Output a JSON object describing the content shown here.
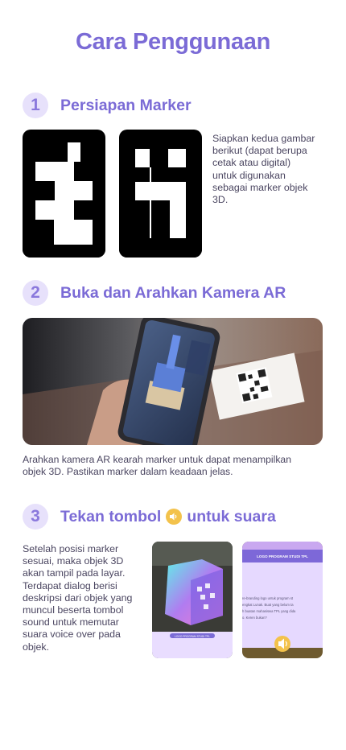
{
  "page": {
    "title": "Cara Penggunaan"
  },
  "step1": {
    "number": "1",
    "title": "Persiapan Marker",
    "description": [
      "Siapkan kedua gambar",
      "berikut (dapat berupa",
      "cetak atau digital)",
      "untuk digunakan",
      "sebagai marker objek",
      "3D."
    ]
  },
  "step2": {
    "number": "2",
    "title": "Buka dan Arahkan Kamera AR",
    "description": [
      "Arahkan kamera AR kearah marker untuk dapat menampilkan",
      "objek 3D. Pastikan marker dalam keadaan jelas."
    ]
  },
  "step3": {
    "number": "3",
    "title_before": "Tekan tombol",
    "title_after": "untuk suara",
    "description": [
      "Setelah posisi marker",
      "sesuai, maka objek 3D",
      "akan tampil pada layar.",
      "Terdapat dialog berisi",
      "deskripsi dari objek yang",
      "muncul beserta tombol",
      "sound untuk memutar",
      "suara voice over pada",
      "objek."
    ],
    "phone2_header": "LOGO PROGRAM STUDI TPL",
    "phone2_text": [
      "re-branding logo untuk program st",
      "engkat Lunak. Buat yang belum ta",
      "h buatan mahasiswa TPL yang dida",
      "o. Keren bukan?"
    ],
    "phone1_label": "LOGO PROGRAM STUDI TPL"
  },
  "colors": {
    "accent": "#7b6bd6",
    "badge_bg": "#e7e1fb",
    "speaker": "#f3c24b",
    "card_bg": "#e6d9ff"
  },
  "icons": {
    "sound": "speaker-icon"
  }
}
